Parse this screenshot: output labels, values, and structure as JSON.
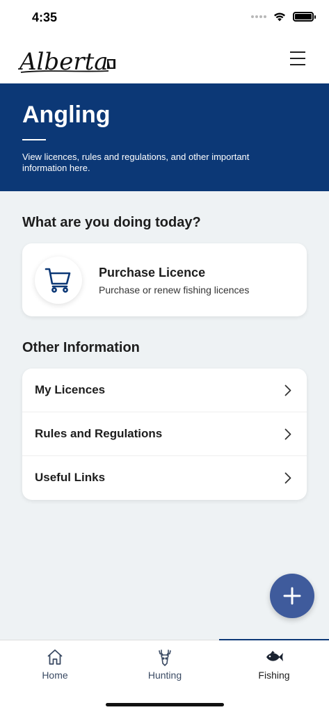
{
  "status_bar": {
    "time": "4:35"
  },
  "header": {
    "logo_text": "Alberta",
    "menu_icon": "hamburger-menu-icon"
  },
  "hero": {
    "title": "Angling",
    "description": "View licences, rules and regulations, and other important information here."
  },
  "today": {
    "heading": "What are you doing today?",
    "card": {
      "icon": "shopping-cart-icon",
      "title": "Purchase Licence",
      "subtitle": "Purchase or renew fishing licences"
    }
  },
  "other": {
    "heading": "Other Information",
    "items": [
      {
        "label": "My Licences"
      },
      {
        "label": "Rules and Regulations"
      },
      {
        "label": "Useful Links"
      }
    ]
  },
  "fab": {
    "icon": "plus-icon"
  },
  "nav": {
    "active": "Fishing",
    "items": [
      {
        "label": "Home",
        "icon": "home-icon"
      },
      {
        "label": "Hunting",
        "icon": "deer-icon"
      },
      {
        "label": "Fishing",
        "icon": "fish-icon"
      }
    ]
  },
  "colors": {
    "hero_bg": "#0c3876",
    "page_bg": "#eef2f4",
    "fab": "#3f5b9c",
    "nav_text": "#3a4a63"
  }
}
